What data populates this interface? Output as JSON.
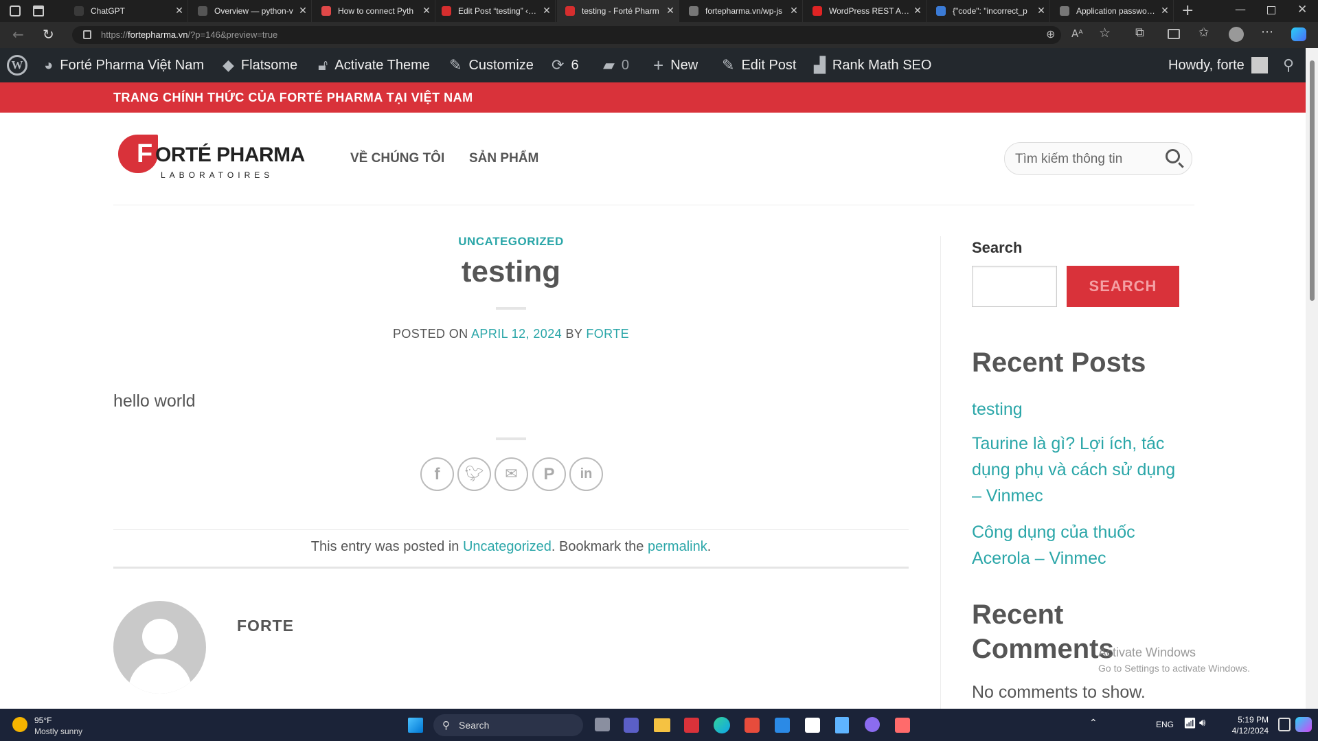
{
  "browser": {
    "tabs": [
      {
        "title": "ChatGPT",
        "color": "#3a3a3a"
      },
      {
        "title": "Overview — python-v",
        "color": "#555"
      },
      {
        "title": "How to connect Pyth",
        "color": "#e04848"
      },
      {
        "title": "Edit Post “testing” ‹ Fo",
        "color": "#d62e2e"
      },
      {
        "title": "testing - Forté Pharm",
        "color": "#d62e2e"
      },
      {
        "title": "fortepharma.vn/wp-js",
        "color": "#777"
      },
      {
        "title": "WordPress REST API /",
        "color": "#e02424"
      },
      {
        "title": "{\"code\": \"incorrect_p",
        "color": "#3b7bd6"
      },
      {
        "title": "Application passwords",
        "color": "#777"
      }
    ],
    "url_prefix": "https://",
    "url_host": "fortepharma.vn",
    "url_path": "/?p=146&preview=true"
  },
  "wpbar": {
    "site_name": "Forté Pharma Việt Nam",
    "theme": "Flatsome",
    "activate": "Activate Theme",
    "customize": "Customize",
    "updates": "6",
    "comments": "0",
    "new": "New",
    "edit": "Edit Post",
    "seo": "Rank Math SEO",
    "howdy": "Howdy, forte"
  },
  "site": {
    "topbar": "TRANG CHÍNH THỨC CỦA FORTÉ PHARMA TẠI VIỆT NAM",
    "logo_main": "ORTÉ PHARMA",
    "logo_f": "F",
    "logo_sub": "LABORATOIRES",
    "nav": [
      "VỀ CHÚNG TÔI",
      "SẢN PHẨM"
    ],
    "search_placeholder": "Tìm kiếm thông tin"
  },
  "post": {
    "category": "UNCATEGORIZED",
    "title": "testing",
    "posted_on": "POSTED ON",
    "date": "APRIL 12, 2024",
    "by": "BY",
    "author": "FORTE",
    "body": "hello world",
    "footer_pre": "This entry was posted in",
    "footer_cat": "Uncategorized",
    "footer_mid": ". Bookmark the",
    "footer_link": "permalink",
    "footer_end": ".",
    "author_box": "FORTE"
  },
  "sidebar": {
    "search_title": "Search",
    "search_button": "SEARCH",
    "recent_posts_title": "Recent Posts",
    "recent_posts": [
      "testing",
      "Taurine là gì? Lợi ích, tác dụng phụ và cách sử dụng – Vinmec",
      "Công dụng của thuốc Acerola – Vinmec"
    ],
    "recent_comments_title": "Recent Comments",
    "no_comments": "No comments to show."
  },
  "watermark": {
    "line1": "Activate Windows",
    "line2": "Go to Settings to activate Windows."
  },
  "taskbar": {
    "temp": "95°F",
    "weather": "Mostly sunny",
    "search": "Search",
    "lang": "ENG",
    "time": "5:19 PM",
    "date": "4/12/2024"
  },
  "colors": {
    "brand_red": "#d9323a",
    "teal": "#2aa6a8",
    "wp_bar": "#23282d"
  }
}
